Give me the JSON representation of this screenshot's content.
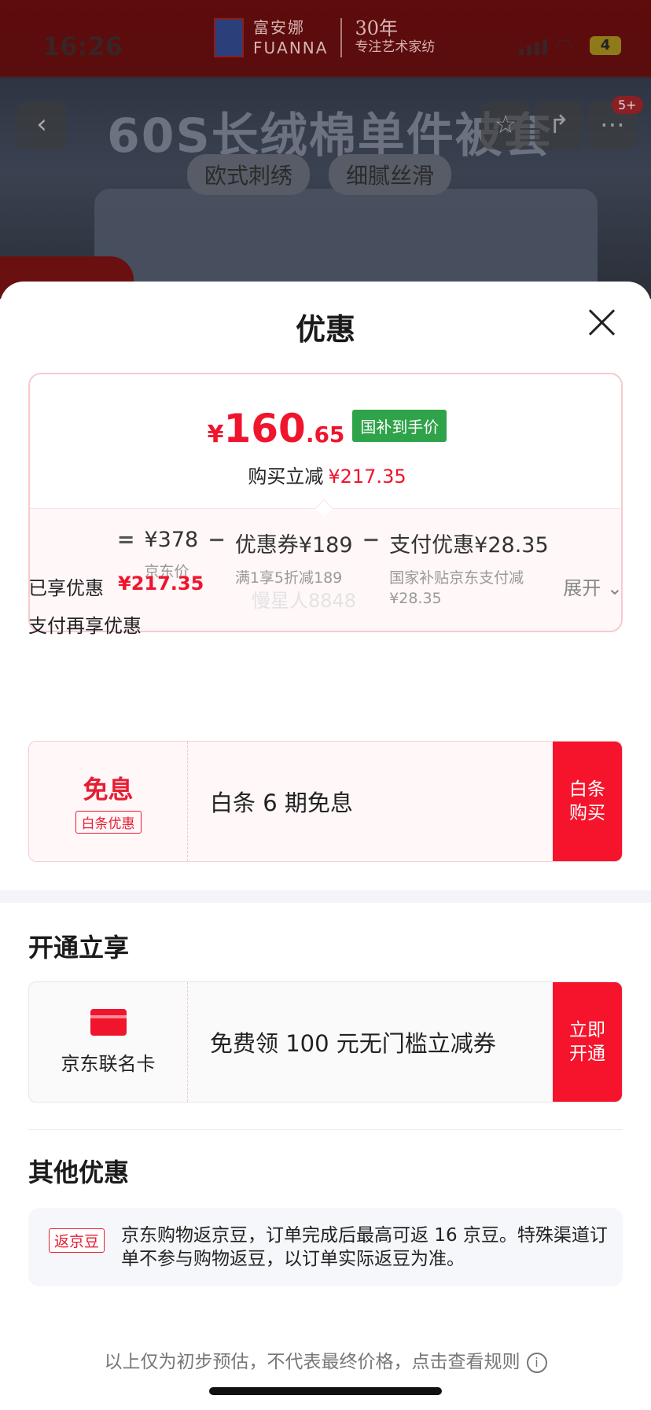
{
  "status_bar": {
    "time": "16:26",
    "battery": "4"
  },
  "background": {
    "brand_name": "富安娜",
    "brand_name_en": "FUANNA",
    "brand_years": "30年",
    "brand_slogan": "专注艺术家纺",
    "headline": "60S长绒棉单件被套",
    "tags": [
      "欧式刺绣",
      "细腻丝滑"
    ],
    "cart_badge": "5+"
  },
  "sheet": {
    "title": "优惠",
    "price": {
      "currency": "¥",
      "integer": "160",
      "decimal": ".65",
      "badge": "国补到手价"
    },
    "reduce": {
      "label": "购买立减",
      "amount": "¥217.35"
    },
    "formula": {
      "eq": "=",
      "minus": "−",
      "items": [
        {
          "top": "¥378",
          "sub": "京东价"
        },
        {
          "top": "优惠券¥189",
          "sub": "满1享5折减189"
        },
        {
          "top": "支付优惠¥28.35",
          "sub": "国家补贴京东支付减¥28.35"
        }
      ]
    },
    "enjoyed": {
      "label": "已享优惠",
      "amount": "¥217.35",
      "expand": "展开"
    },
    "watermark": "慢星人8848",
    "pay_more": "支付再享优惠",
    "baitiao": {
      "big": "免息",
      "tag": "白条优惠",
      "desc": "白条 6 期免息",
      "action": "白条购买"
    },
    "open_section": "开通立享",
    "card_offer": {
      "name": "京东联名卡",
      "desc": "免费领 100 元无门槛立减券",
      "action": "立即开通"
    },
    "other_section": "其他优惠",
    "jingdou": {
      "tag": "返京豆",
      "text": "京东购物返京豆，订单完成后最高可返 16 京豆。特殊渠道订单不参与购物返豆，以订单实际返豆为准。"
    },
    "footnote": "以上仅为初步预估，不代表最终价格，点击查看规则",
    "info_icon": "i"
  },
  "colors": {
    "accent": "#f0142d",
    "green_badge": "#2fa34a"
  }
}
